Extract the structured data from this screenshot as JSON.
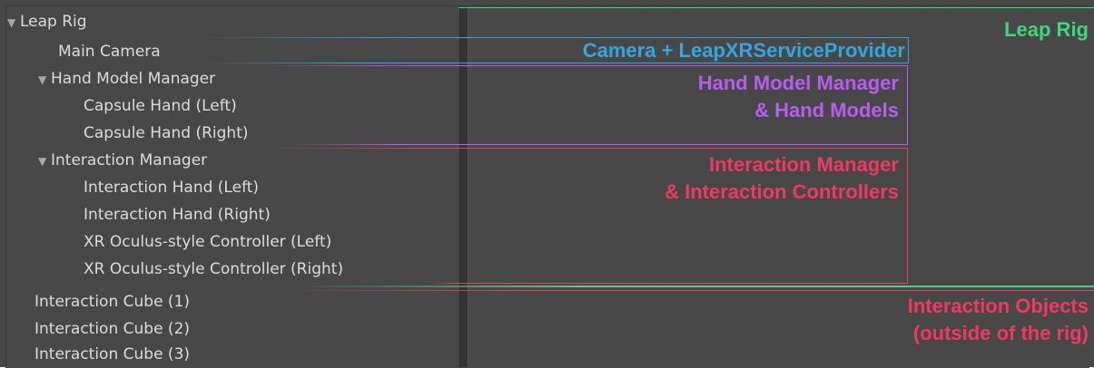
{
  "hierarchy": [
    {
      "label": "Leap Rig",
      "expanded": true
    },
    {
      "label": "Main Camera"
    },
    {
      "label": "Hand Model Manager",
      "expanded": true
    },
    {
      "label": "Capsule Hand (Left)"
    },
    {
      "label": "Capsule Hand (Right)"
    },
    {
      "label": "Interaction Manager",
      "expanded": true
    },
    {
      "label": "Interaction Hand (Left)"
    },
    {
      "label": "Interaction Hand (Right)"
    },
    {
      "label": "XR Oculus-style Controller (Left)"
    },
    {
      "label": "XR Oculus-style Controller (Right)"
    },
    {
      "label": "Interaction Cube (1)"
    },
    {
      "label": "Interaction Cube (2)"
    },
    {
      "label": "Interaction Cube (3)"
    }
  ],
  "annotations": {
    "leap_rig": {
      "line1": "Leap Rig",
      "color": "#3ed67e"
    },
    "camera": {
      "line1": "Camera + LeapXRServiceProvider",
      "color": "#33a6df"
    },
    "hand_models": {
      "line1": "Hand Model Manager",
      "line2": "& Hand Models",
      "color": "#b95cf0"
    },
    "interaction_manager": {
      "line1": "Interaction Manager",
      "line2": "& Interaction Controllers",
      "color": "#f0395f"
    },
    "interaction_objects": {
      "line1": "Interaction Objects",
      "line2": "(outside of the rig)",
      "color": "#f0395f"
    }
  },
  "icons": {
    "expand": "▼"
  }
}
